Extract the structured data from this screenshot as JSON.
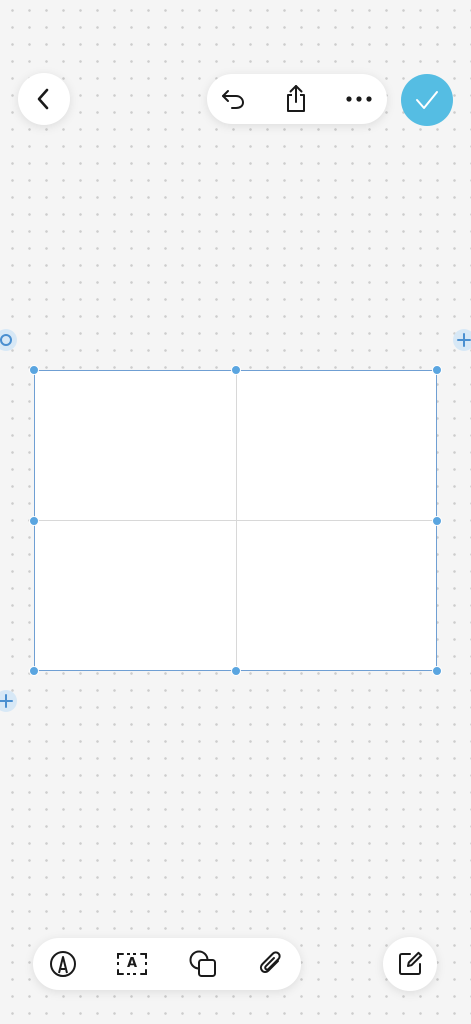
{
  "toolbar_top": {
    "back": {
      "icon": "chevron-left-icon"
    },
    "actions": [
      {
        "name": "undo-button",
        "icon": "undo-icon"
      },
      {
        "name": "share-button",
        "icon": "share-icon"
      },
      {
        "name": "more-button",
        "icon": "more-horizontal-icon"
      }
    ],
    "done": {
      "icon": "checkmark-icon",
      "color": "#55bde3"
    }
  },
  "canvas": {
    "element": "table",
    "rows": 2,
    "columns": 2,
    "cells": [
      [
        "",
        ""
      ],
      [
        "",
        ""
      ]
    ],
    "selection_color": "#5aa5e0",
    "row_handle": {
      "icon": "circle-handle-icon"
    },
    "add_column": {
      "icon": "plus-icon"
    },
    "add_row": {
      "icon": "plus-icon"
    }
  },
  "toolbar_bottom": {
    "tools": [
      {
        "name": "pen-tool-button",
        "icon": "pen-icon"
      },
      {
        "name": "text-box-button",
        "icon": "text-box-icon",
        "glyph": "A"
      },
      {
        "name": "shapes-button",
        "icon": "shapes-icon"
      },
      {
        "name": "attachment-button",
        "icon": "paperclip-icon"
      }
    ],
    "compose": {
      "icon": "compose-icon"
    }
  },
  "colors": {
    "background": "#f5f5f5",
    "dots": "#cdcdcd",
    "accent": "#55bde3",
    "selection": "#5aa5e0"
  }
}
